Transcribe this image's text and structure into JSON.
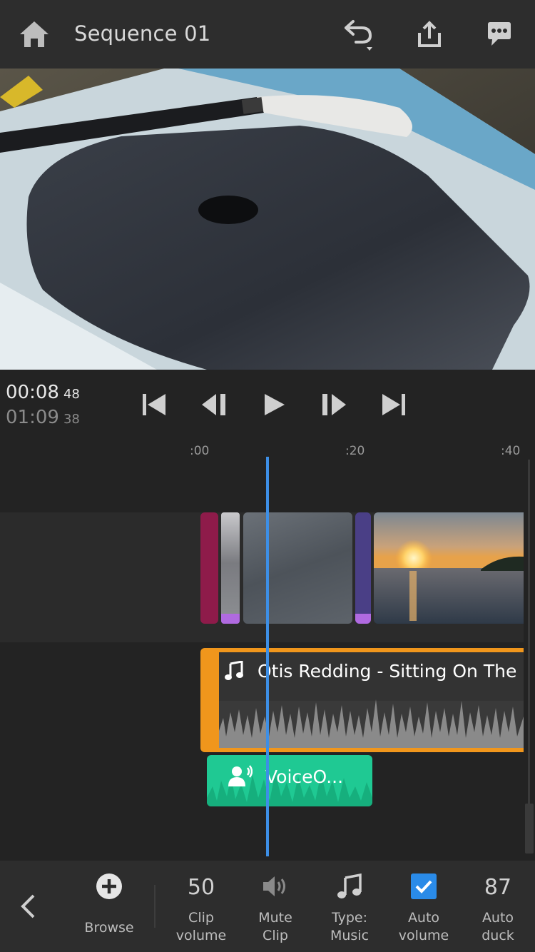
{
  "header": {
    "title": "Sequence 01",
    "icons": [
      "home-icon",
      "undo-icon",
      "share-icon",
      "feedback-icon"
    ]
  },
  "transport": {
    "current_time": "00:08",
    "current_frames": "48",
    "total_time": "01:09",
    "total_frames": "38"
  },
  "ruler": {
    "ticks": [
      ":00",
      ":20",
      ":40"
    ]
  },
  "tracks": {
    "music_clip_title": "Otis Redding - Sitting On The Dc",
    "voiceover_clip_title": "VoiceO..."
  },
  "toolbar": {
    "browse_label": "Browse",
    "clip_volume_value": "50",
    "clip_volume_label_1": "Clip",
    "clip_volume_label_2": "volume",
    "mute_label_1": "Mute",
    "mute_label_2": "Clip",
    "type_label_1": "Type:",
    "type_label_2": "Music",
    "auto_volume_label_1": "Auto",
    "auto_volume_label_2": "volume",
    "auto_volume_checked": true,
    "auto_duck_value": "87",
    "auto_duck_label_1": "Auto",
    "auto_duck_label_2": "duck"
  },
  "colors": {
    "accent_blue": "#3d8fe6",
    "music_orange": "#f0961c",
    "voice_green": "#1fc993",
    "clip_magenta": "#8e1b4a",
    "clip_purple": "#4a3f86"
  }
}
